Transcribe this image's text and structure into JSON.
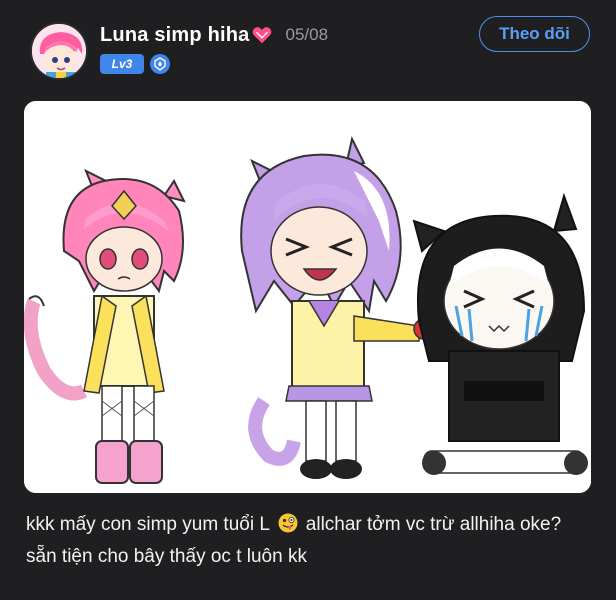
{
  "post": {
    "username": "Luna simp hiha",
    "date": "05/08",
    "level_badge": "Lv3",
    "follow_label": "Theo dõi",
    "caption_part1": "kkk mấy con simp yum tuổi L",
    "caption_part2": "allchar tởm vc trừ allhiha oke? sẵn tiện cho bây thấy oc t luôn kk"
  },
  "icons": {
    "heart": "pink-heart-icon",
    "medal": "shield-medal-icon",
    "emoji": "zany-face-emoji"
  },
  "colors": {
    "background": "#1f1f21",
    "accent": "#3f86e8",
    "follow": "#4a92ee"
  }
}
